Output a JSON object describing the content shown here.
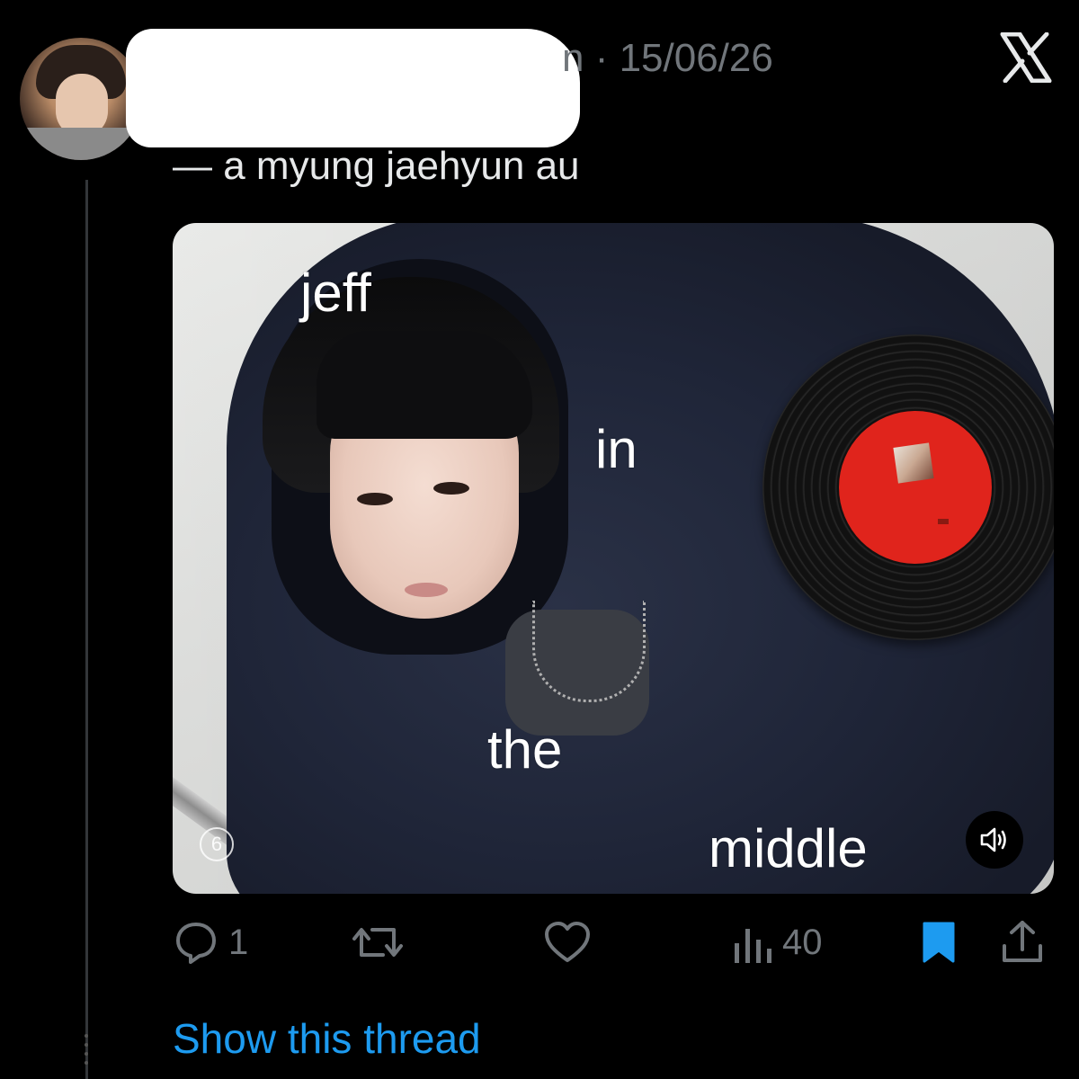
{
  "tweet": {
    "meta": "n · 15/06/26",
    "text": "— a myung jaehyun au",
    "media": {
      "overlay_words": [
        "jeff",
        "in",
        "the",
        "middle"
      ],
      "count_badge": "6",
      "sound_icon": "speaker-icon"
    },
    "actions": {
      "reply_count": "1",
      "retweet_count": "",
      "like_count": "",
      "views_count": "40"
    },
    "show_thread": "Show this thread"
  },
  "colors": {
    "background": "#000000",
    "text": "#e7e9ea",
    "muted": "#71767b",
    "accent": "#1d9bf0",
    "vinyl_label": "#e0241c"
  }
}
